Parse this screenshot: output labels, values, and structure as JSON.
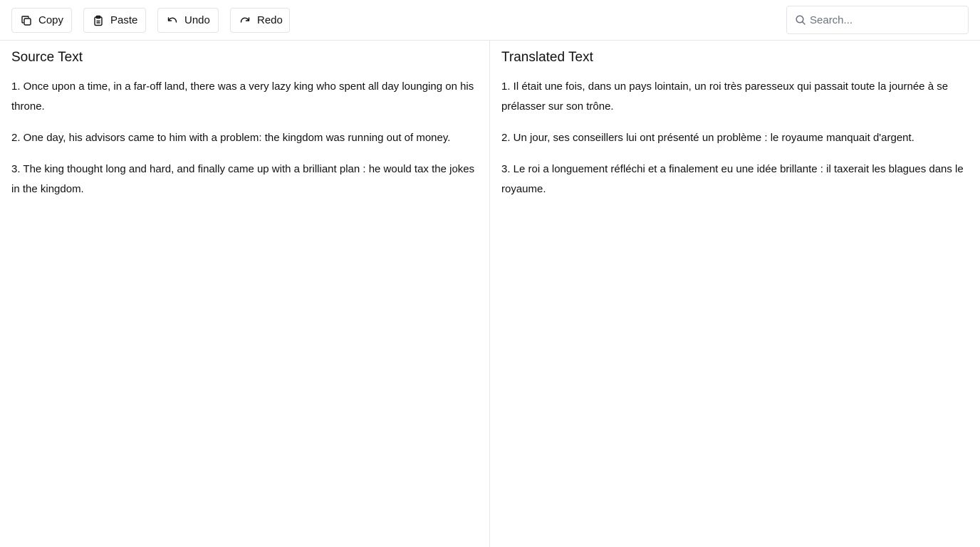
{
  "toolbar": {
    "copy_label": "Copy",
    "paste_label": "Paste",
    "undo_label": "Undo",
    "redo_label": "Redo",
    "icons": {
      "copy": "copy-icon",
      "paste": "clipboard-icon",
      "undo": "undo-icon",
      "redo": "redo-icon"
    }
  },
  "search": {
    "placeholder": "Search...",
    "value": "",
    "icon": "search-icon"
  },
  "source": {
    "title": "Source Text",
    "paragraphs": [
      "1. Once upon a time, in a far-off land, there was a very lazy king who spent all day lounging on his throne.",
      "2. One day, his advisors came to him with a problem: the kingdom was running out of money.",
      "3. The king thought long and hard, and finally came up with a brilliant plan : he would tax the jokes in the kingdom."
    ]
  },
  "translated": {
    "title": "Translated Text",
    "paragraphs": [
      "1. Il était une fois, dans un pays lointain, un roi très paresseux qui passait toute la journée à se prélasser sur son trône.",
      "2. Un jour, ses conseillers lui ont présenté un problème : le royaume manquait d'argent.",
      "3. Le roi a longuement réfléchi et a finalement eu une idée brillante : il taxerait les blagues dans le royaume."
    ]
  },
  "colors": {
    "border": "#e2e4e8",
    "text": "#111111",
    "placeholder": "#6b7280"
  }
}
